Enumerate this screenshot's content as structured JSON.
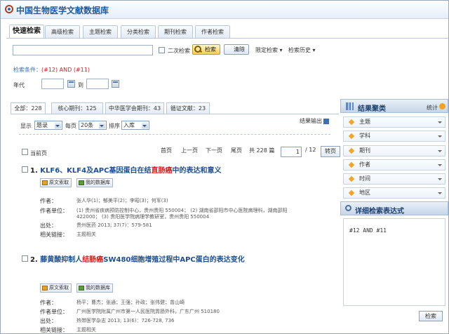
{
  "app": {
    "title": "中国生物医学文献数据库"
  },
  "tabs": [
    "快速检索",
    "高级检索",
    "主题检索",
    "分类检索",
    "期刊检索",
    "作者检索"
  ],
  "search": {
    "secondary_label": "二次检索",
    "search_button": "检索",
    "clear_button": "清除",
    "limit_label": "限定检索",
    "history_label": "检索历史",
    "condition_label": "检索条件：",
    "condition_value": "(#12) AND (#11)",
    "year_label": "年代",
    "to_label": "到"
  },
  "result_tabs": [
    {
      "label": "全部：",
      "count": "228"
    },
    {
      "label": "核心期刊：",
      "count": "125"
    },
    {
      "label": "中华医学会期刊：",
      "count": "43"
    },
    {
      "label": "循证文献：",
      "count": "23"
    }
  ],
  "toolbar": {
    "display_label": "显示",
    "display_value": "题录",
    "perpage_label": "每页",
    "perpage_value": "20条",
    "sort_label": "排序",
    "sort_value": "入库",
    "export_label": "结果输出"
  },
  "pager": {
    "current_page_label": "当前页",
    "first": "首页",
    "prev": "上一页",
    "next": "下一页",
    "last": "尾页",
    "total": "共 228 篇",
    "page_value": "1",
    "page_total": "/ 12",
    "go": "转页"
  },
  "records": [
    {
      "number": "1.",
      "title_before": "KLF6、KLF4及APC基因蛋白在结",
      "title_highlight": "直肠癌",
      "title_after": "中的表达和意义",
      "btn_fulltext": "原文索取",
      "btn_mydb": "我的数据库",
      "author_label": "作者：",
      "authors": "张人华(1)；郁美平(2)；李昭(3)；何军(3)",
      "affiliation_label": "作者单位：",
      "affiliation_lines": [
        "(1) 贵州省疾病预防控制中心，贵州贵阳 550004； (2) 湖南省邵阳市中心医院病理科，湖南邵阳",
        "422000； (3) 贵阳医学院病理学教研室，贵州贵阳 550004"
      ],
      "source_label": "出处：",
      "source": "贵州医药 2013; 37(7)：579-581",
      "related_label": "相关链接：",
      "related": "主题相关"
    },
    {
      "number": "2.",
      "title_before": "藤黄酸抑制人",
      "title_highlight": "结肠癌",
      "title_after": "SW480细胞增殖过程中APC蛋白的表达变化",
      "btn_fulltext": "原文索取",
      "btn_mydb": "我的数据库",
      "author_label": "作者：",
      "authors": "杨平；曹杰；张通；王强；孙政；张伟健；曾山崎",
      "affiliation_label": "作者单位：",
      "affiliation_lines": [
        "广州医学院附属广州市第一人民医院胃肠外科，广东广州 510180"
      ],
      "source_label": "出处：",
      "source": "热带医学杂志 2013; 13(6)：726-728, 736",
      "related_label": "相关链接：",
      "related": "主题相关"
    }
  ],
  "sidebar": {
    "title": "结果聚类",
    "stat_label": "统计",
    "facets": [
      "主题",
      "学科",
      "期刊",
      "作者",
      "时间",
      "地区"
    ],
    "expr_title": "详细检索表达式",
    "expr_value": "#12 AND #11",
    "expr_button": "检索"
  }
}
